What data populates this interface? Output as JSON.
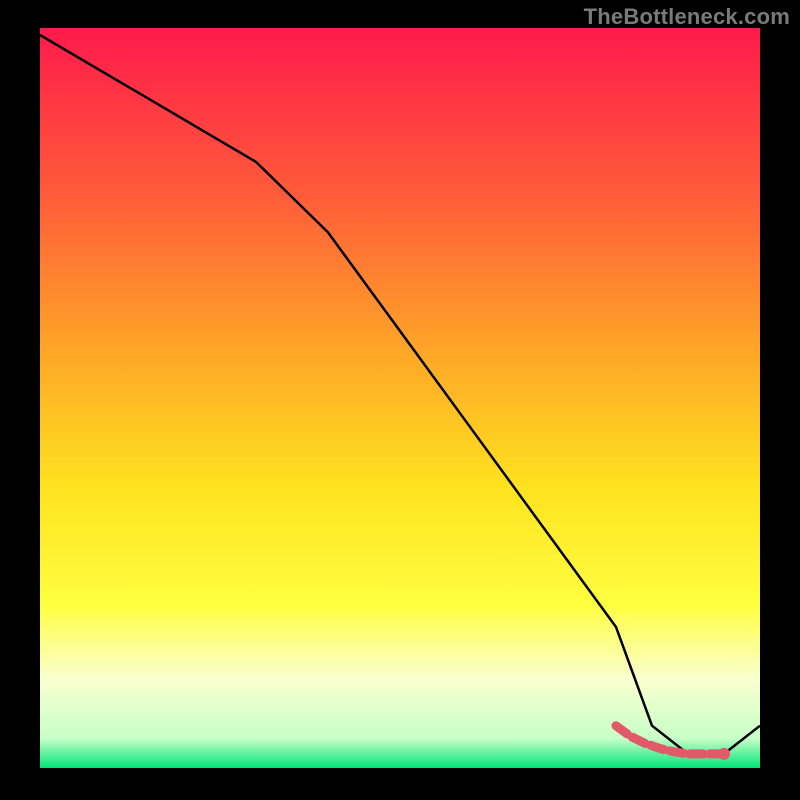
{
  "watermark": "TheBottleneck.com",
  "colors": {
    "gradient_top": "#ff1a4b",
    "gradient_mid1": "#ff7a2b",
    "gradient_mid2": "#ffd21f",
    "gradient_mid3": "#ffff33",
    "gradient_mid4": "#f7ffcf",
    "gradient_bottom": "#00e676",
    "line": "#000000",
    "marker": "#e05a6a",
    "frame_bg": "#000000"
  },
  "chart_data": {
    "type": "line",
    "title": "",
    "xlabel": "",
    "ylabel": "",
    "x": [
      0,
      10,
      20,
      30,
      40,
      50,
      60,
      70,
      80,
      85,
      90,
      95,
      100
    ],
    "values": [
      104,
      98,
      92,
      86,
      76,
      62,
      48,
      34,
      20,
      6,
      2,
      2,
      6
    ],
    "ylim": [
      0,
      105
    ],
    "xlim": [
      0,
      100
    ],
    "grid": false,
    "legend": false,
    "highlight_segment": {
      "x": [
        80,
        82,
        84,
        86,
        88,
        90,
        92,
        94,
        95
      ],
      "values": [
        6,
        4.5,
        3.5,
        2.8,
        2.3,
        2,
        2,
        2,
        2
      ]
    }
  }
}
